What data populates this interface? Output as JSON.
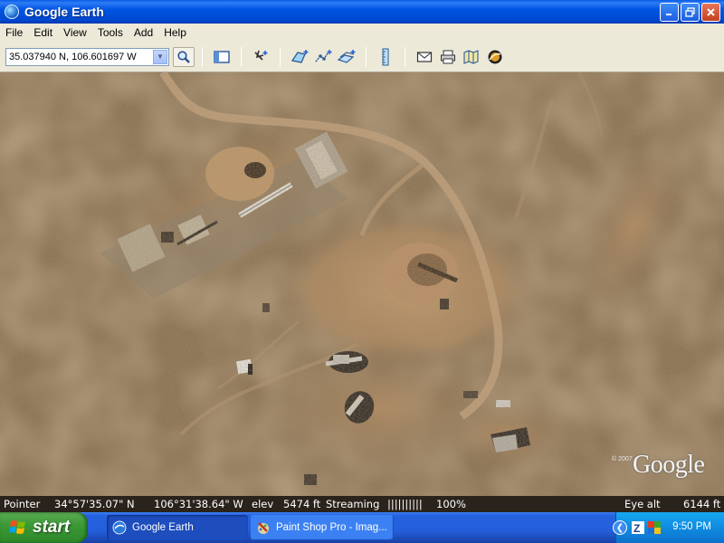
{
  "window": {
    "title": "Google Earth",
    "buttons": [
      "minimize",
      "restore",
      "close"
    ]
  },
  "menu": [
    "File",
    "Edit",
    "View",
    "Tools",
    "Add",
    "Help"
  ],
  "toolbar": {
    "location_value": "35.037940 N, 106.601697 W",
    "icons": [
      "search-icon",
      "sidebar-toggle-icon",
      "placemark-icon",
      "polygon-icon",
      "path-icon",
      "image-overlay-icon",
      "ruler-icon",
      "email-icon",
      "print-icon",
      "google-maps-icon",
      "sky-icon"
    ]
  },
  "map": {
    "copyright": "© 2007",
    "logo": "Google"
  },
  "status": {
    "pointer_label": "Pointer",
    "lat": "34°57'35.07\" N",
    "lon": "106°31'38.64\" W",
    "elev_label": "elev",
    "elev": "5474 ft",
    "streaming_label": "Streaming",
    "streaming_bars": "||||||||||",
    "streaming_pct": "100%",
    "eye_label": "Eye alt",
    "eye_alt": "6144 ft"
  },
  "taskbar": {
    "start": "start",
    "tasks": [
      {
        "label": "Google Earth",
        "active": true
      },
      {
        "label": "Paint Shop Pro - Imag...",
        "active": false
      }
    ],
    "clock": "9:50 PM"
  },
  "colors": {
    "title_bar": "#0054e3",
    "terrain": "#8d7352",
    "start_button": "#3c9a37",
    "tray": "#0f8be0"
  }
}
